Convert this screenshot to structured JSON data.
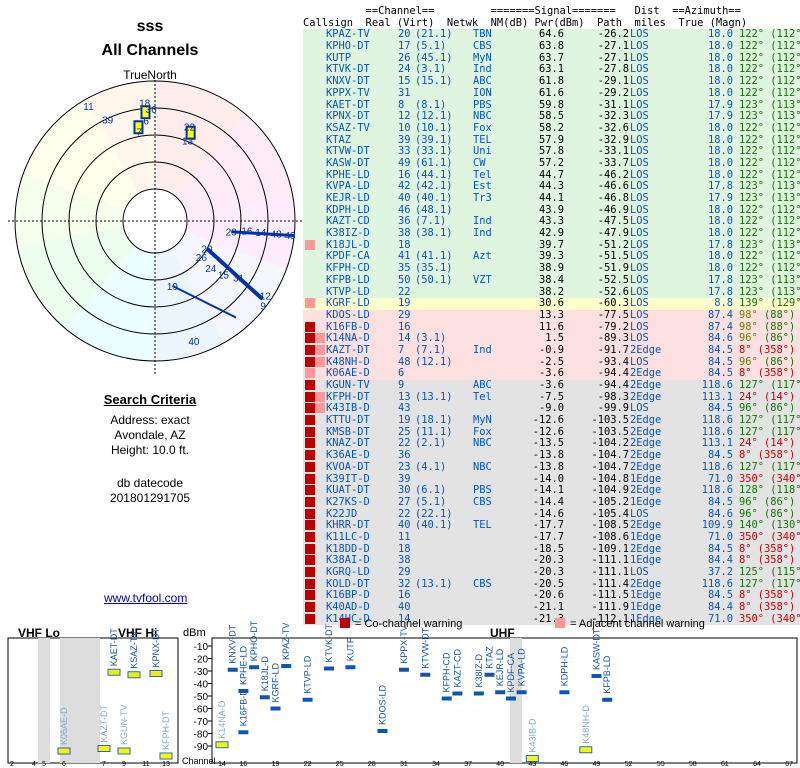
{
  "header": {
    "title1": "sss",
    "title2": "All Channels",
    "truenorth": "TrueNorth"
  },
  "criteria": {
    "heading": "Search Criteria",
    "address": "Address: exact",
    "city": "Avondale, AZ",
    "height": "Height: 10.0 ft.",
    "db_label": "db datecode",
    "db_value": "201801291705"
  },
  "link": "www.tvfool.com",
  "table_header": {
    "line1": "          ==Channel==         =======Signal=======   Dist  ==Azimuth==",
    "line2": "Callsign  Real (Virt)  Netwk  NM(dB) Pwr(dBm)  Path  miles  True (Magn)"
  },
  "colors": {
    "green": "#dff5df",
    "yellow": "#ffffcc",
    "pink": "#fde0e0",
    "gray": "#e3e3e3",
    "blue": "#0055cc",
    "red": "#cc0000"
  },
  "rows": [
    {
      "call": "KPAZ-TV",
      "real": "20",
      "virt": "(21.1)",
      "net": "TBN",
      "nm": "64.6",
      "pwr": "-26.2",
      "path": "LOS",
      "mi": "18.0",
      "true": "122°",
      "magn": "(112°)",
      "band": "green",
      "mark": ""
    },
    {
      "call": "KPHO-DT",
      "real": "17",
      "virt": "(5.1)",
      "net": "CBS",
      "nm": "63.8",
      "pwr": "-27.1",
      "path": "LOS",
      "mi": "18.0",
      "true": "122°",
      "magn": "(112°)",
      "band": "green",
      "mark": ""
    },
    {
      "call": "KUTP",
      "real": "26",
      "virt": "(45.1)",
      "net": "MyN",
      "nm": "63.7",
      "pwr": "-27.1",
      "path": "LOS",
      "mi": "18.0",
      "true": "122°",
      "magn": "(112°)",
      "band": "green",
      "mark": ""
    },
    {
      "call": "KTVK-DT",
      "real": "24",
      "virt": "(3.1)",
      "net": "Ind",
      "nm": "63.1",
      "pwr": "-27.8",
      "path": "LOS",
      "mi": "18.0",
      "true": "122°",
      "magn": "(112°)",
      "band": "green",
      "mark": ""
    },
    {
      "call": "KNXV-DT",
      "real": "15",
      "virt": "(15.1)",
      "net": "ABC",
      "nm": "61.8",
      "pwr": "-29.1",
      "path": "LOS",
      "mi": "18.0",
      "true": "122°",
      "magn": "(112°)",
      "band": "green",
      "mark": ""
    },
    {
      "call": "KPPX-TV",
      "real": "31",
      "virt": "",
      "net": "ION",
      "nm": "61.6",
      "pwr": "-29.2",
      "path": "LOS",
      "mi": "18.0",
      "true": "122°",
      "magn": "(112°)",
      "band": "green",
      "mark": ""
    },
    {
      "call": "KAET-DT",
      "real": "8",
      "virt": "(8.1)",
      "net": "PBS",
      "nm": "59.8",
      "pwr": "-31.1",
      "path": "LOS",
      "mi": "17.9",
      "true": "123°",
      "magn": "(113°)",
      "band": "green",
      "mark": ""
    },
    {
      "call": "KPNX-DT",
      "real": "12",
      "virt": "(12.1)",
      "net": "NBC",
      "nm": "58.5",
      "pwr": "-32.3",
      "path": "LOS",
      "mi": "17.9",
      "true": "123°",
      "magn": "(113°)",
      "band": "green",
      "mark": ""
    },
    {
      "call": "KSAZ-TV",
      "real": "10",
      "virt": "(10.1)",
      "net": "Fox",
      "nm": "58.2",
      "pwr": "-32.6",
      "path": "LOS",
      "mi": "18.0",
      "true": "122°",
      "magn": "(112°)",
      "band": "green",
      "mark": ""
    },
    {
      "call": "KTAZ",
      "real": "39",
      "virt": "(39.1)",
      "net": "TEL",
      "nm": "57.9",
      "pwr": "-32.9",
      "path": "LOS",
      "mi": "18.0",
      "true": "122°",
      "magn": "(112°)",
      "band": "green",
      "mark": ""
    },
    {
      "call": "KTVW-DT",
      "real": "33",
      "virt": "(33.1)",
      "net": "Uni",
      "nm": "57.8",
      "pwr": "-33.1",
      "path": "LOS",
      "mi": "18.0",
      "true": "122°",
      "magn": "(112°)",
      "band": "green",
      "mark": ""
    },
    {
      "call": "KASW-DT",
      "real": "49",
      "virt": "(61.1)",
      "net": "CW",
      "nm": "57.2",
      "pwr": "-33.7",
      "path": "LOS",
      "mi": "18.0",
      "true": "122°",
      "magn": "(112°)",
      "band": "green",
      "mark": ""
    },
    {
      "call": "KPHE-LD",
      "real": "16",
      "virt": "(44.1)",
      "net": "Tel",
      "nm": "44.7",
      "pwr": "-46.2",
      "path": "LOS",
      "mi": "18.0",
      "true": "122°",
      "magn": "(112°)",
      "band": "green",
      "mark": ""
    },
    {
      "call": "KVPA-LD",
      "real": "42",
      "virt": "(42.1)",
      "net": "Est",
      "nm": "44.3",
      "pwr": "-46.6",
      "path": "LOS",
      "mi": "17.8",
      "true": "123°",
      "magn": "(113°)",
      "band": "green",
      "mark": ""
    },
    {
      "call": "KEJR-LD",
      "real": "40",
      "virt": "(40.1)",
      "net": "Tr3",
      "nm": "44.1",
      "pwr": "-46.8",
      "path": "LOS",
      "mi": "17.9",
      "true": "123°",
      "magn": "(113°)",
      "band": "green",
      "mark": ""
    },
    {
      "call": "KDPH-LD",
      "real": "46",
      "virt": "(48.1)",
      "net": "",
      "nm": "43.9",
      "pwr": "-46.9",
      "path": "LOS",
      "mi": "18.0",
      "true": "122°",
      "magn": "(112°)",
      "band": "green",
      "mark": ""
    },
    {
      "call": "KAZT-CD",
      "real": "36",
      "virt": "(7.1)",
      "net": "Ind",
      "nm": "43.3",
      "pwr": "-47.5",
      "path": "LOS",
      "mi": "18.0",
      "true": "122°",
      "magn": "(112°)",
      "band": "green",
      "mark": ""
    },
    {
      "call": "K38IZ-D",
      "real": "38",
      "virt": "(38.1)",
      "net": "Ind",
      "nm": "42.9",
      "pwr": "-47.9",
      "path": "LOS",
      "mi": "18.0",
      "true": "122°",
      "magn": "(112°)",
      "band": "green",
      "mark": ""
    },
    {
      "call": "K18JL-D",
      "real": "18",
      "virt": "",
      "net": "",
      "nm": "39.7",
      "pwr": "-51.2",
      "path": "LOS",
      "mi": "17.8",
      "true": "123°",
      "magn": "(113°)",
      "band": "green",
      "mark": "a"
    },
    {
      "call": "KPDF-CA",
      "real": "41",
      "virt": "(41.1)",
      "net": "Azt",
      "nm": "39.3",
      "pwr": "-51.5",
      "path": "LOS",
      "mi": "18.0",
      "true": "122°",
      "magn": "(112°)",
      "band": "green",
      "mark": ""
    },
    {
      "call": "KFPH-CD",
      "real": "35",
      "virt": "(35.1)",
      "net": "",
      "nm": "38.9",
      "pwr": "-51.9",
      "path": "LOS",
      "mi": "18.0",
      "true": "122°",
      "magn": "(112°)",
      "band": "green",
      "mark": ""
    },
    {
      "call": "KFPB-LD",
      "real": "50",
      "virt": "(50.1)",
      "net": "VZT",
      "nm": "38.4",
      "pwr": "-52.5",
      "path": "LOS",
      "mi": "17.8",
      "true": "123°",
      "magn": "(113°)",
      "band": "green",
      "mark": ""
    },
    {
      "call": "KTVP-LD",
      "real": "22",
      "virt": "",
      "net": "",
      "nm": "38.2",
      "pwr": "-52.6",
      "path": "LOS",
      "mi": "17.8",
      "true": "123°",
      "magn": "(113°)",
      "band": "green",
      "mark": ""
    },
    {
      "call": "KGRF-LD",
      "real": "19",
      "virt": "",
      "net": "",
      "nm": "30.6",
      "pwr": "-60.3",
      "path": "LOS",
      "mi": "8.8",
      "true": "139°",
      "magn": "(129°)",
      "band": "yellow",
      "mark": "a"
    },
    {
      "call": "KDOS-LD",
      "real": "29",
      "virt": "",
      "net": "",
      "nm": "13.3",
      "pwr": "-77.5",
      "path": "LOS",
      "mi": "87.4",
      "true": "98°",
      "magn": "(88°)",
      "band": "pink",
      "mark": ""
    },
    {
      "call": "K16FB-D",
      "real": "16",
      "virt": "",
      "net": "",
      "nm": "11.6",
      "pwr": "-79.2",
      "path": "LOS",
      "mi": "87.4",
      "true": "98°",
      "magn": "(88°)",
      "band": "pink",
      "mark": "c"
    },
    {
      "call": "K14NA-D",
      "real": "14",
      "virt": "(3.1)",
      "net": "",
      "nm": "1.5",
      "pwr": "-89.3",
      "path": "LOS",
      "mi": "84.6",
      "true": "96°",
      "magn": "(86°)",
      "band": "pink",
      "mark": "ca"
    },
    {
      "call": "KAZT-DT",
      "real": "7",
      "virt": "(7.1)",
      "net": "Ind",
      "nm": "-0.9",
      "pwr": "-91.7",
      "path": "2Edge",
      "mi": "84.5",
      "true": "8°",
      "magn": "(358°)",
      "band": "pink",
      "mark": "ca"
    },
    {
      "call": "K48NH-D",
      "real": "48",
      "virt": "(12.1)",
      "net": "",
      "nm": "-2.5",
      "pwr": "-93.4",
      "path": "LOS",
      "mi": "84.5",
      "true": "96°",
      "magn": "(86°)",
      "band": "pink",
      "mark": "ca"
    },
    {
      "call": "K06AE-D",
      "real": "6",
      "virt": "",
      "net": "",
      "nm": "-3.6",
      "pwr": "-94.4",
      "path": "2Edge",
      "mi": "84.5",
      "true": "8°",
      "magn": "(358°)",
      "band": "pink",
      "mark": "a"
    },
    {
      "call": "KGUN-TV",
      "real": "9",
      "virt": "",
      "net": "ABC",
      "nm": "-3.6",
      "pwr": "-94.4",
      "path": "2Edge",
      "mi": "118.6",
      "true": "127°",
      "magn": "(117°)",
      "band": "gray",
      "mark": "c"
    },
    {
      "call": "KFPH-DT",
      "real": "13",
      "virt": "(13.1)",
      "net": "Tel",
      "nm": "-7.5",
      "pwr": "-98.3",
      "path": "2Edge",
      "mi": "113.1",
      "true": "24°",
      "magn": "(14°)",
      "band": "gray",
      "mark": "ca"
    },
    {
      "call": "K43IB-D",
      "real": "43",
      "virt": "",
      "net": "",
      "nm": "-9.0",
      "pwr": "-99.9",
      "path": "LOS",
      "mi": "84.5",
      "true": "96°",
      "magn": "(86°)",
      "band": "gray",
      "mark": "ca"
    },
    {
      "call": "KTTU-DT",
      "real": "19",
      "virt": "(18.1)",
      "net": "MyN",
      "nm": "-12.6",
      "pwr": "-103.5",
      "path": "2Edge",
      "mi": "118.6",
      "true": "127°",
      "magn": "(117°)",
      "band": "gray",
      "mark": "c"
    },
    {
      "call": "KMSB-DT",
      "real": "25",
      "virt": "(11.1)",
      "net": "Fox",
      "nm": "-12.6",
      "pwr": "-103.5",
      "path": "2Edge",
      "mi": "118.6",
      "true": "127°",
      "magn": "(117°)",
      "band": "gray",
      "mark": "c"
    },
    {
      "call": "KNAZ-DT",
      "real": "22",
      "virt": "(2.1)",
      "net": "NBC",
      "nm": "-13.5",
      "pwr": "-104.2",
      "path": "2Edge",
      "mi": "113.1",
      "true": "24°",
      "magn": "(14°)",
      "band": "gray",
      "mark": "c"
    },
    {
      "call": "K36AE-D",
      "real": "36",
      "virt": "",
      "net": "",
      "nm": "-13.8",
      "pwr": "-104.7",
      "path": "2Edge",
      "mi": "84.5",
      "true": "8°",
      "magn": "(358°)",
      "band": "gray",
      "mark": "c"
    },
    {
      "call": "KVOA-DT",
      "real": "23",
      "virt": "(4.1)",
      "net": "NBC",
      "nm": "-13.8",
      "pwr": "-104.7",
      "path": "2Edge",
      "mi": "118.6",
      "true": "127°",
      "magn": "(117°)",
      "band": "gray",
      "mark": "c"
    },
    {
      "call": "K39IT-D",
      "real": "39",
      "virt": "",
      "net": "",
      "nm": "-14.0",
      "pwr": "-104.8",
      "path": "1Edge",
      "mi": "71.0",
      "true": "350°",
      "magn": "(340°)",
      "band": "gray",
      "mark": "c"
    },
    {
      "call": "KUAT-DT",
      "real": "30",
      "virt": "(6.1)",
      "net": "PBS",
      "nm": "-14.1",
      "pwr": "-104.9",
      "path": "2Edge",
      "mi": "118.6",
      "true": "128°",
      "magn": "(118°)",
      "band": "gray",
      "mark": "c"
    },
    {
      "call": "K27KS-D",
      "real": "27",
      "virt": "(5.1)",
      "net": "CBS",
      "nm": "-14.4",
      "pwr": "-105.2",
      "path": "1Edge",
      "mi": "84.5",
      "true": "96°",
      "magn": "(86°)",
      "band": "gray",
      "mark": "c"
    },
    {
      "call": "K22JD",
      "real": "22",
      "virt": "(22.1)",
      "net": "",
      "nm": "-14.6",
      "pwr": "-105.4",
      "path": "LOS",
      "mi": "84.6",
      "true": "96°",
      "magn": "(86°)",
      "band": "gray",
      "mark": "c"
    },
    {
      "call": "KHRR-DT",
      "real": "40",
      "virt": "(40.1)",
      "net": "TEL",
      "nm": "-17.7",
      "pwr": "-108.5",
      "path": "2Edge",
      "mi": "109.9",
      "true": "140°",
      "magn": "(130°)",
      "band": "gray",
      "mark": "c"
    },
    {
      "call": "K11LC-D",
      "real": "11",
      "virt": "",
      "net": "",
      "nm": "-17.7",
      "pwr": "-108.6",
      "path": "1Edge",
      "mi": "71.0",
      "true": "350°",
      "magn": "(340°)",
      "band": "gray",
      "mark": "c"
    },
    {
      "call": "K18DD-D",
      "real": "18",
      "virt": "",
      "net": "",
      "nm": "-18.5",
      "pwr": "-109.1",
      "path": "2Edge",
      "mi": "84.5",
      "true": "8°",
      "magn": "(358°)",
      "band": "gray",
      "mark": "c"
    },
    {
      "call": "K38AI-D",
      "real": "38",
      "virt": "",
      "net": "",
      "nm": "-20.3",
      "pwr": "-111.1",
      "path": "1Edge",
      "mi": "84.4",
      "true": "8°",
      "magn": "(358°)",
      "band": "gray",
      "mark": "c"
    },
    {
      "call": "KGRQ-LD",
      "real": "29",
      "virt": "",
      "net": "",
      "nm": "-20.3",
      "pwr": "-111.1",
      "path": "LOS",
      "mi": "37.2",
      "true": "125°",
      "magn": "(115°)",
      "band": "gray",
      "mark": "c"
    },
    {
      "call": "KOLD-DT",
      "real": "32",
      "virt": "(13.1)",
      "net": "CBS",
      "nm": "-20.5",
      "pwr": "-111.4",
      "path": "2Edge",
      "mi": "118.6",
      "true": "127°",
      "magn": "(117°)",
      "band": "gray",
      "mark": "c"
    },
    {
      "call": "K16BP-D",
      "real": "16",
      "virt": "",
      "net": "",
      "nm": "-20.6",
      "pwr": "-111.5",
      "path": "1Edge",
      "mi": "84.5",
      "true": "8°",
      "magn": "(358°)",
      "band": "gray",
      "mark": "c"
    },
    {
      "call": "K40AD-D",
      "real": "40",
      "virt": "",
      "net": "",
      "nm": "-21.1",
      "pwr": "-111.9",
      "path": "1Edge",
      "mi": "84.4",
      "true": "8°",
      "magn": "(358°)",
      "band": "gray",
      "mark": "c"
    },
    {
      "call": "K14HC-D",
      "real": "14",
      "virt": "",
      "net": "",
      "nm": "-21.3",
      "pwr": "-112.1",
      "path": "1Edge",
      "mi": "71.0",
      "true": "350°",
      "magn": "(340°)",
      "band": "gray",
      "mark": "c"
    }
  ],
  "radar_labels": [
    {
      "t": "18",
      "a": 355,
      "r": 0.85
    },
    {
      "t": "36",
      "a": 358,
      "r": 0.8
    },
    {
      "t": "6",
      "a": 355,
      "r": 0.72
    },
    {
      "t": "7",
      "a": 350,
      "r": 0.65
    },
    {
      "t": "22",
      "a": 20,
      "r": 0.72
    },
    {
      "t": "13",
      "a": 22,
      "r": 0.62
    },
    {
      "t": "11",
      "a": 330,
      "r": 0.95
    },
    {
      "t": "39",
      "a": 335,
      "r": 0.8
    },
    {
      "t": "29",
      "a": 98,
      "r": 0.55
    },
    {
      "t": "16",
      "a": 96,
      "r": 0.66
    },
    {
      "t": "14",
      "a": 96,
      "r": 0.76
    },
    {
      "t": "48",
      "a": 96,
      "r": 0.87
    },
    {
      "t": "43",
      "a": 96,
      "r": 0.97
    },
    {
      "t": "20",
      "a": 118,
      "r": 0.42
    },
    {
      "t": "26",
      "a": 128,
      "r": 0.42
    },
    {
      "t": "24",
      "a": 130,
      "r": 0.52
    },
    {
      "t": "15",
      "a": 128,
      "r": 0.62
    },
    {
      "t": "31",
      "a": 124,
      "r": 0.72
    },
    {
      "t": "19",
      "a": 165,
      "r": 0.48
    },
    {
      "t": "40",
      "a": 162,
      "r": 0.9
    },
    {
      "t": "12",
      "a": 124,
      "r": 0.95
    },
    {
      "t": "9",
      "a": 128,
      "r": 0.98
    }
  ],
  "bottom": {
    "vhf_lo": "VHF Lo",
    "vhf_hi": "VHF Hi",
    "uhf": "UHF",
    "dbm": "dBm",
    "channel": "Channel",
    "co_legend": "= Co-channel warning",
    "adj_legend": "= Adjacent channel warning",
    "yticks": [
      "-10",
      "-20",
      "-30",
      "-40",
      "-50",
      "-60",
      "-70",
      "-80",
      "-90"
    ],
    "vhf_channels": [
      "2",
      "4",
      "5",
      "6",
      "7",
      "9",
      "11",
      "13"
    ],
    "uhf_channels": [
      "14",
      "16",
      "19",
      "22",
      "25",
      "28",
      "31",
      "34",
      "37",
      "40",
      "43",
      "46",
      "49",
      "52",
      "55",
      "58",
      "61",
      "64",
      "67",
      "69"
    ],
    "stations_vhf": [
      {
        "name": "KAET-DT",
        "ch": 8,
        "pwr": -31
      },
      {
        "name": "KSAZ-TV",
        "ch": 10,
        "pwr": -33
      },
      {
        "name": "KPNX-DT",
        "ch": 12,
        "pwr": -32
      },
      {
        "name": "K06AE-D",
        "ch": 6,
        "pwr": -94
      },
      {
        "name": "KAZT-DT",
        "ch": 7,
        "pwr": -92
      },
      {
        "name": "KGUN-TV",
        "ch": 9,
        "pwr": -94
      },
      {
        "name": "KFPH-DT",
        "ch": 13,
        "pwr": -98
      }
    ],
    "stations_uhf": [
      {
        "name": "KNXV-DT",
        "ch": 15,
        "pwr": -29
      },
      {
        "name": "KPHE-LD",
        "ch": 16,
        "pwr": -46
      },
      {
        "name": "KPHO-DT",
        "ch": 17,
        "pwr": -27
      },
      {
        "name": "K18JL-D",
        "ch": 18,
        "pwr": -51
      },
      {
        "name": "KGRF-LD",
        "ch": 19,
        "pwr": -60
      },
      {
        "name": "KPAZ-TV",
        "ch": 20,
        "pwr": -26
      },
      {
        "name": "KTVP-LD",
        "ch": 22,
        "pwr": -53
      },
      {
        "name": "KTVK-DT",
        "ch": 24,
        "pwr": -28
      },
      {
        "name": "KUTP",
        "ch": 26,
        "pwr": -27
      },
      {
        "name": "KDOS-LD",
        "ch": 29,
        "pwr": -78
      },
      {
        "name": "KPPX-TV",
        "ch": 31,
        "pwr": -29
      },
      {
        "name": "KTVW-DT",
        "ch": 33,
        "pwr": -33
      },
      {
        "name": "KFPH-CD",
        "ch": 35,
        "pwr": -52
      },
      {
        "name": "KAZT-CD",
        "ch": 36,
        "pwr": -48
      },
      {
        "name": "K38IZ-D",
        "ch": 38,
        "pwr": -48
      },
      {
        "name": "KTAZ",
        "ch": 39,
        "pwr": -33
      },
      {
        "name": "KEJR-LD",
        "ch": 40,
        "pwr": -47
      },
      {
        "name": "KPDF-CA",
        "ch": 41,
        "pwr": -52
      },
      {
        "name": "KVPA-LD",
        "ch": 42,
        "pwr": -47
      },
      {
        "name": "KDPH-LD",
        "ch": 46,
        "pwr": -47
      },
      {
        "name": "KASW-DT",
        "ch": 49,
        "pwr": -34
      },
      {
        "name": "KFPB-LD",
        "ch": 50,
        "pwr": -53
      },
      {
        "name": "K48NH-D",
        "ch": 48,
        "pwr": -93
      },
      {
        "name": "K14NA-D",
        "ch": 14,
        "pwr": -89
      },
      {
        "name": "K16FB-D",
        "ch": 16,
        "pwr": -79
      },
      {
        "name": "K43IB-D",
        "ch": 43,
        "pwr": -100
      }
    ]
  }
}
